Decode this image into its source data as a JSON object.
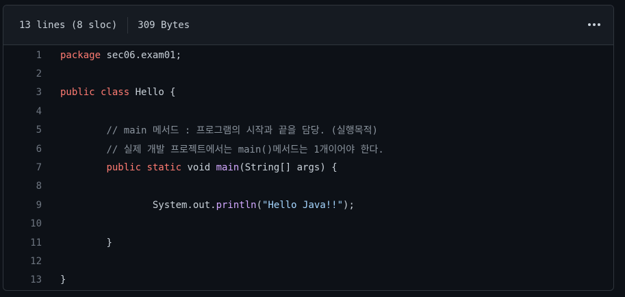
{
  "header": {
    "lines_info": "13 lines (8 sloc)",
    "size_info": "309 Bytes",
    "menu_icon": "kebab-horizontal-icon"
  },
  "colors": {
    "background": "#0d1117",
    "header_bg": "#161b22",
    "border": "#30363d",
    "text": "#c9d1d9",
    "keyword": "#ff7b72",
    "function": "#d2a8ff",
    "string": "#a5d6ff",
    "comment": "#8b949e",
    "line_number": "#6e7681"
  },
  "code": {
    "lines": [
      {
        "num": "1",
        "tokens": [
          {
            "t": "package",
            "c": "kw"
          },
          {
            "t": " sec06.exam01;",
            "c": "tx"
          }
        ]
      },
      {
        "num": "2",
        "tokens": []
      },
      {
        "num": "3",
        "tokens": [
          {
            "t": "public",
            "c": "kw"
          },
          {
            "t": " ",
            "c": "tx"
          },
          {
            "t": "class",
            "c": "kw"
          },
          {
            "t": " Hello {",
            "c": "tx"
          }
        ]
      },
      {
        "num": "4",
        "tokens": []
      },
      {
        "num": "5",
        "tokens": [
          {
            "t": "\t\t// main 메서드 : 프로그램의 시작과 끝을 담당. (실행목적)",
            "c": "cm"
          }
        ]
      },
      {
        "num": "6",
        "tokens": [
          {
            "t": "\t\t// 실제 개발 프로젝트에서는 main()메서드는 1개이어야 한다.",
            "c": "cm"
          }
        ]
      },
      {
        "num": "7",
        "tokens": [
          {
            "t": "\t\t",
            "c": "tx"
          },
          {
            "t": "public",
            "c": "kw"
          },
          {
            "t": " ",
            "c": "tx"
          },
          {
            "t": "static",
            "c": "kw"
          },
          {
            "t": " void ",
            "c": "tx"
          },
          {
            "t": "main",
            "c": "fn"
          },
          {
            "t": "(String[] args) {",
            "c": "tx"
          }
        ]
      },
      {
        "num": "8",
        "tokens": []
      },
      {
        "num": "9",
        "tokens": [
          {
            "t": "\t\t\t\tSystem.out.",
            "c": "tx"
          },
          {
            "t": "println",
            "c": "fn"
          },
          {
            "t": "(",
            "c": "tx"
          },
          {
            "t": "\"Hello Java!!\"",
            "c": "str"
          },
          {
            "t": ");",
            "c": "tx"
          }
        ]
      },
      {
        "num": "10",
        "tokens": []
      },
      {
        "num": "11",
        "tokens": [
          {
            "t": "\t\t}",
            "c": "tx"
          }
        ]
      },
      {
        "num": "12",
        "tokens": []
      },
      {
        "num": "13",
        "tokens": [
          {
            "t": "}",
            "c": "tx"
          }
        ]
      }
    ]
  }
}
